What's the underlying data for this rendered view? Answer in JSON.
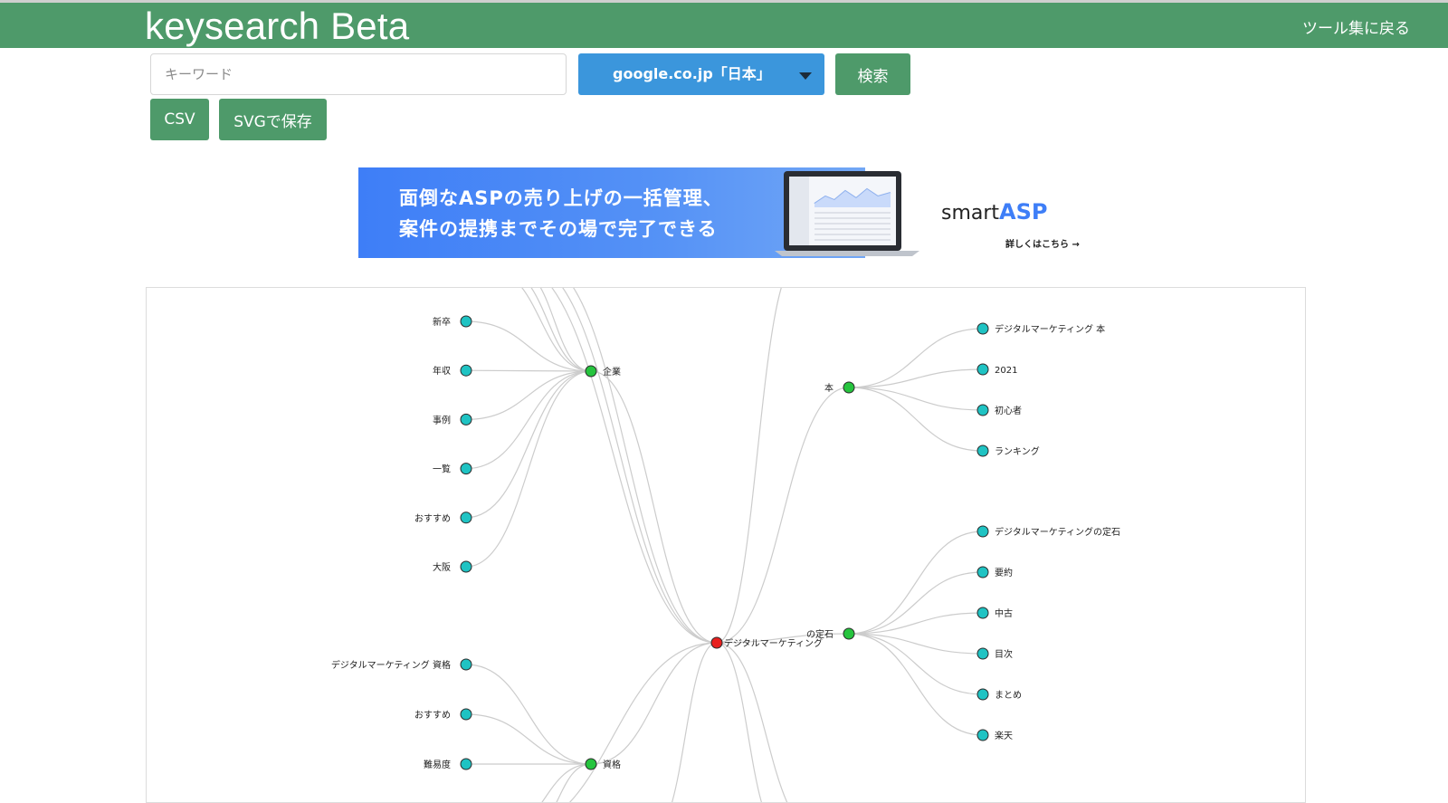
{
  "header": {
    "brand": "keysearch Beta",
    "back_link": "ツール集に戻る",
    "color": "#4e9a6a"
  },
  "search": {
    "placeholder": "キーワード",
    "value": "",
    "engine": "google.co.jp「日本」",
    "submit_label": "検索"
  },
  "actions": {
    "csv_label": "CSV",
    "svg_label": "SVGで保存"
  },
  "ad": {
    "line1": "面倒なASPの売り上げの一括管理、",
    "line2": "案件の提携までその場で完了できる",
    "logo_prefix": "smart",
    "logo_suffix": "ASP",
    "more": "詳しくはこちら →"
  },
  "mindmap": {
    "colors": {
      "root": "#e8201f",
      "category": "#26c43e",
      "leaf": "#1fc3c3"
    },
    "root": {
      "label": "デジタルマーケティング"
    },
    "categories": [
      {
        "label": "企業",
        "children": [
          "新卒",
          "年収",
          "事例",
          "一覧",
          "おすすめ",
          "大阪"
        ]
      },
      {
        "label": "資格",
        "children": [
          "デジタルマーケティング 資格",
          "おすすめ",
          "難易度"
        ]
      },
      {
        "label": "本",
        "children": [
          "デジタルマーケティング 本",
          "2021",
          "初心者",
          "ランキング"
        ]
      },
      {
        "label": "の定石",
        "children": [
          "デジタルマーケティングの定石",
          "要約",
          "中古",
          "目次",
          "まとめ",
          "楽天"
        ]
      }
    ]
  }
}
